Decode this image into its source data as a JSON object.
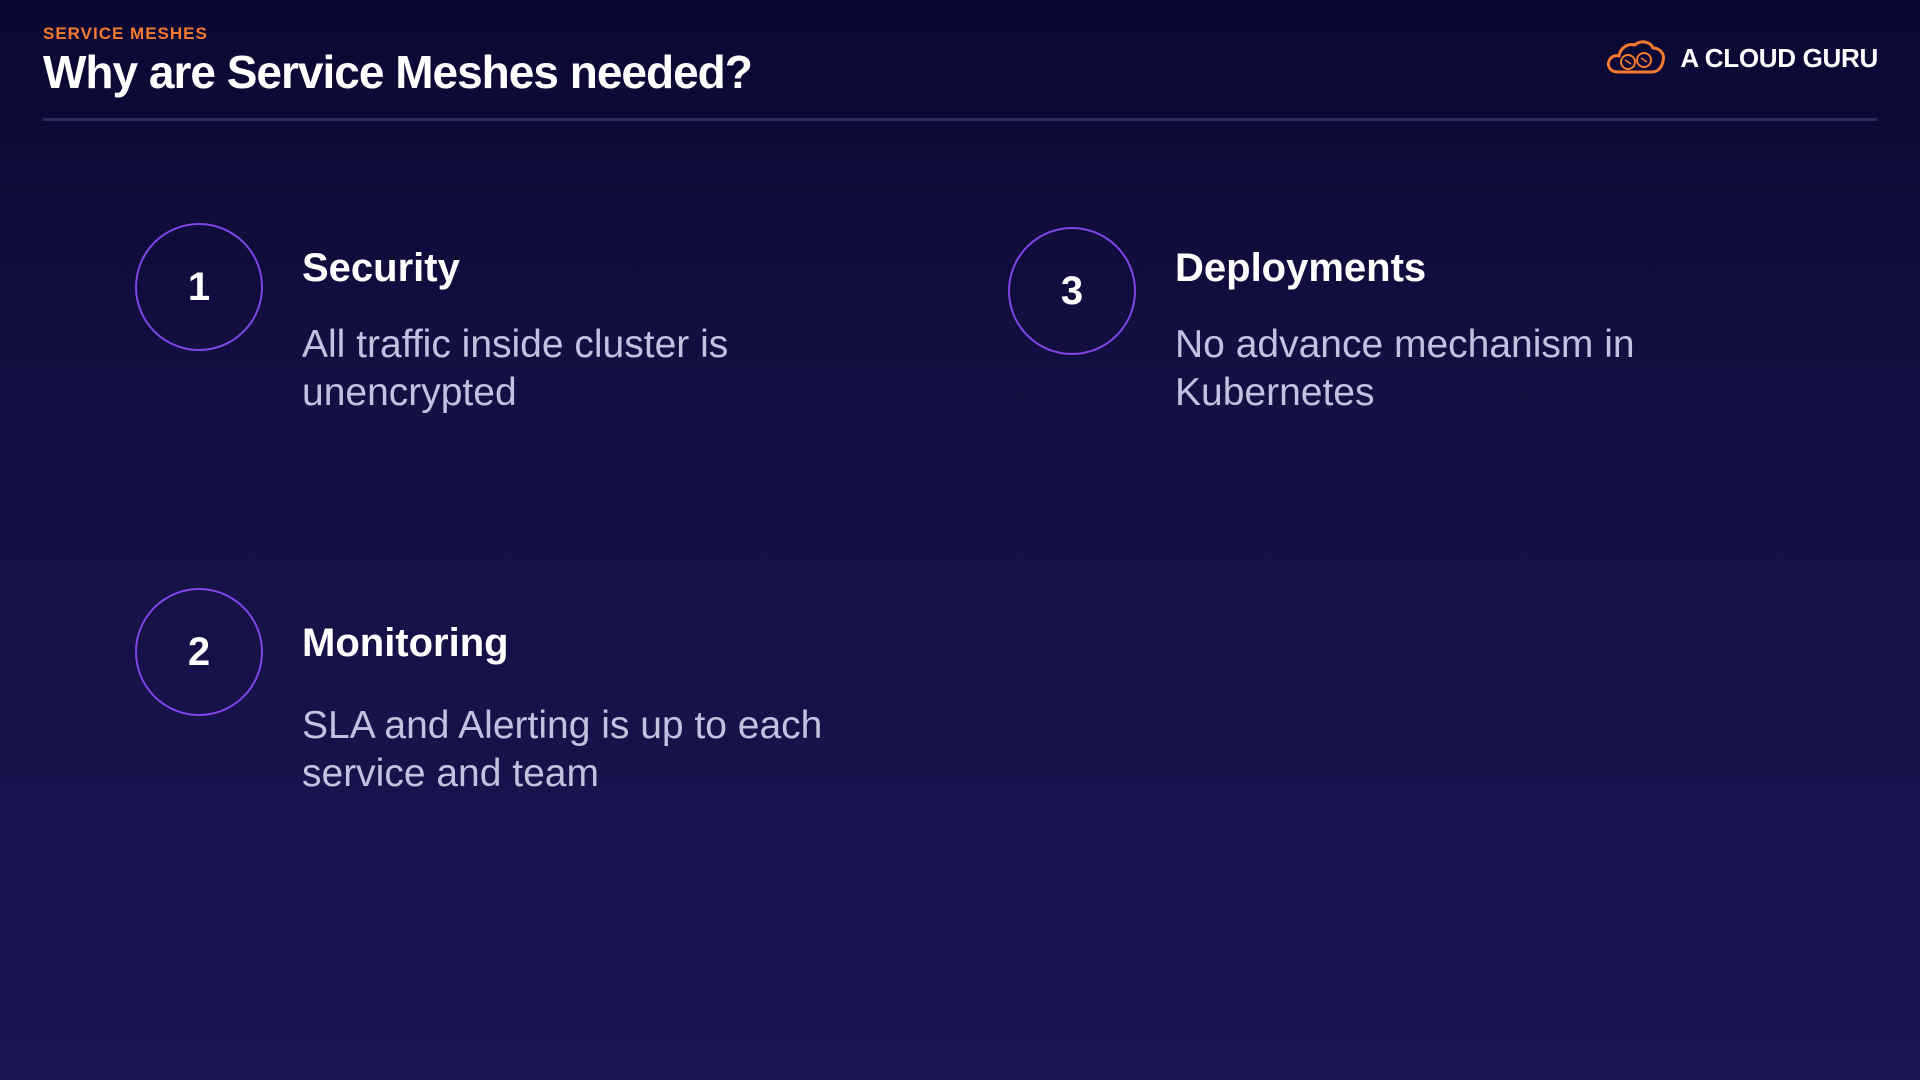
{
  "header": {
    "eyebrow": "SERVICE MESHES",
    "title": "Why are Service Meshes needed?"
  },
  "brand": {
    "name": "A CLOUD GURU",
    "icon": "cloud-logo-icon",
    "accent": "#f47a30"
  },
  "items": [
    {
      "number": "1",
      "title": "Security",
      "description": "All traffic inside cluster is unencrypted"
    },
    {
      "number": "2",
      "title": "Monitoring",
      "description": "SLA and Alerting is up to each service and team"
    },
    {
      "number": "3",
      "title": "Deployments",
      "description": "No advance mechanism in Kubernetes"
    }
  ],
  "colors": {
    "background": "#141044",
    "circle_border": "#8045e6",
    "description_text": "#c3c0e0"
  }
}
